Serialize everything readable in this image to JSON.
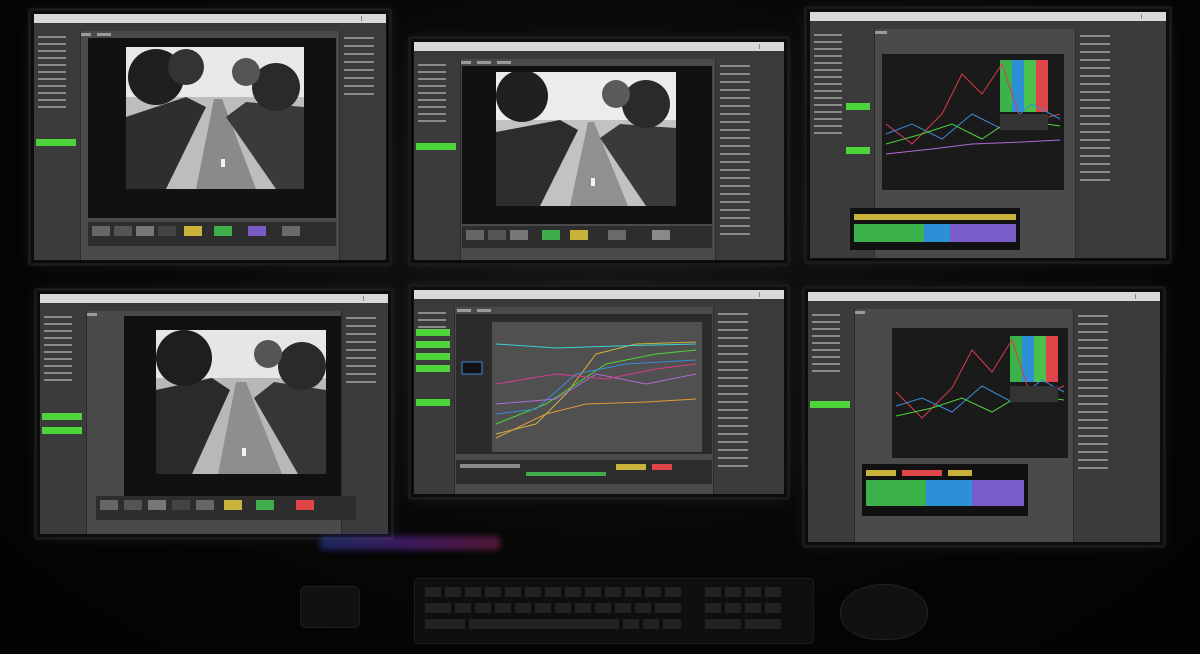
{
  "scene": {
    "description_free": true,
    "monitors": [
      {
        "id": "top-left",
        "content": "photo-editor"
      },
      {
        "id": "top-center",
        "content": "photo-editor"
      },
      {
        "id": "top-right",
        "content": "color-scopes"
      },
      {
        "id": "bottom-left",
        "content": "photo-editor"
      },
      {
        "id": "bottom-center",
        "content": "curve-graph"
      },
      {
        "id": "bottom-right",
        "content": "color-scopes"
      }
    ]
  },
  "colors": {
    "accent_green": "#4cd43a",
    "scope_bars": [
      "#3cb34a",
      "#2d8fd6",
      "#49c14a",
      "#e0454a"
    ],
    "ui_gray": "#4a4a4a"
  },
  "icons": {
    "window_controls": "window-controls-icon",
    "keyboard": "keyboard",
    "mouse": "mouse"
  }
}
